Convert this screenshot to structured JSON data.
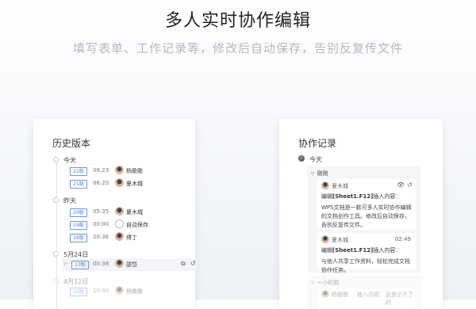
{
  "hero": {
    "title": "多人实时协作编辑",
    "subtitle": "填写表单、工作记录等，修改后自动保存，告别反复传文件"
  },
  "history": {
    "title": "历史版本",
    "groups": [
      {
        "day": "今天",
        "rows": [
          {
            "version": "22版",
            "time": "08:23",
            "author": "杨歌歌"
          },
          {
            "version": "21版",
            "time": "06:20",
            "author": "夏木城"
          }
        ]
      },
      {
        "day": "昨天",
        "rows": [
          {
            "version": "20版",
            "time": "05:35",
            "author": "夏木城"
          },
          {
            "version": "19版",
            "time": "00:00",
            "author": "自动保存"
          },
          {
            "version": "18版",
            "time": "20:36",
            "author": "傅丁"
          }
        ]
      },
      {
        "day": "5月24日",
        "rows": [
          {
            "version": "17版",
            "time": "00:38",
            "author": "邵岱"
          }
        ]
      },
      {
        "day": "4月12日",
        "rows": [
          {
            "version": "16版",
            "time": "10:30",
            "author": "杨歌歌"
          }
        ]
      }
    ]
  },
  "collab": {
    "title": "协作记录",
    "today": "今天",
    "just_now": "刚刚",
    "entries": [
      {
        "name": "夏木城",
        "time": "",
        "action_prefix": "编辑",
        "cell": "[Sheet1.F12]",
        "action_suffix": "插入内容：",
        "content": "WPS文档是一款可多人实时协作编辑的文档创作工具。修改后自动保存，告别反复传文件。"
      },
      {
        "name": "夏木城",
        "time": "02:49",
        "action_prefix": "编辑",
        "cell": "[Sheet1.F12]",
        "action_suffix": "插入内容：",
        "content": "与他人共享工作资料，轻松完成文档协作任务。"
      }
    ],
    "hour_ago": "一小时前",
    "hour_entry": {
      "name": "杨歌歌",
      "action": "插入内容：",
      "content": "这是示不了的"
    }
  },
  "icons": {
    "eye": "eye-icon",
    "restore": "restore-icon",
    "copy": "copy-icon",
    "check": "check-icon"
  }
}
